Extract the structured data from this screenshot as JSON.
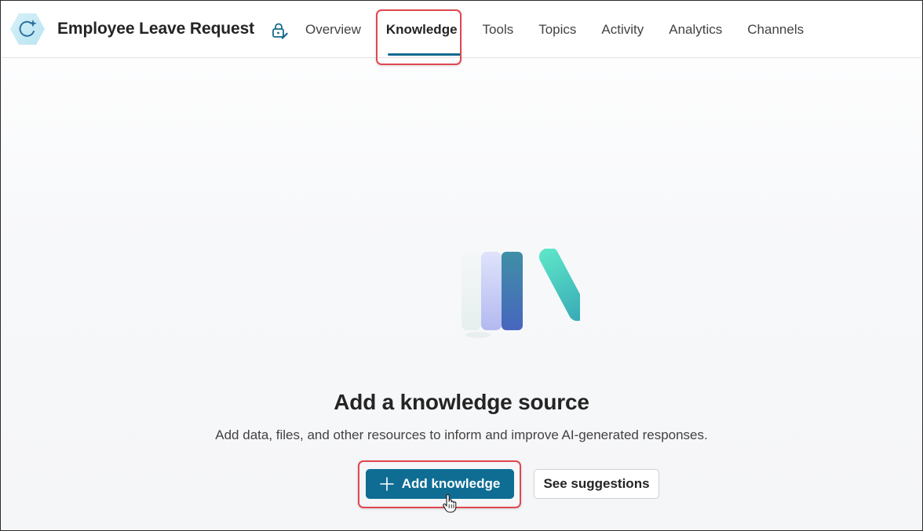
{
  "header": {
    "title": "Employee Leave Request",
    "agent_icon": "agent-hexagon-sparkle-icon",
    "lock_icon": "lock-edit-icon"
  },
  "tabs": [
    {
      "label": "Overview",
      "active": false
    },
    {
      "label": "Knowledge",
      "active": true
    },
    {
      "label": "Tools",
      "active": false
    },
    {
      "label": "Topics",
      "active": false
    },
    {
      "label": "Activity",
      "active": false
    },
    {
      "label": "Analytics",
      "active": false
    },
    {
      "label": "Channels",
      "active": false
    }
  ],
  "empty_state": {
    "illustration": "books-icon",
    "title": "Add a knowledge source",
    "description": "Add data, files, and other resources to inform and improve AI-generated responses.",
    "primary_button": "Add knowledge",
    "secondary_button": "See suggestions"
  },
  "colors": {
    "accent": "#0f6d94",
    "highlight": "#e0474f",
    "text": "#242424"
  }
}
